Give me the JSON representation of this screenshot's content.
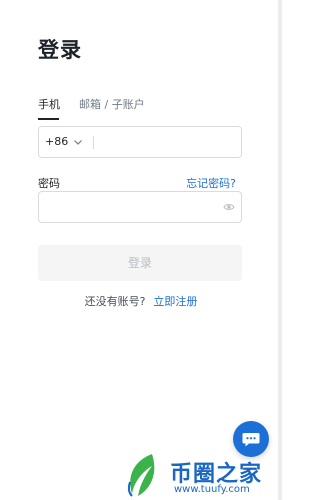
{
  "header": {
    "title": "登录"
  },
  "tabs": [
    {
      "label": "手机",
      "active": true
    },
    {
      "label": "邮箱 / 子账户",
      "active": false
    }
  ],
  "phone": {
    "country_code": "+86",
    "value": "",
    "chevron_icon": "chevron-down-icon"
  },
  "password": {
    "label": "密码",
    "forgot_label": "忘记密码?",
    "value": "",
    "toggle_icon": "eye-icon"
  },
  "login_button": {
    "label": "登录",
    "enabled": false
  },
  "signup": {
    "prompt": "还没有账号?",
    "link_label": "立即注册"
  },
  "chat": {
    "icon": "chat-bubble-icon"
  },
  "watermark": {
    "title": "币圈之家",
    "url": "www.tuufy.com"
  },
  "colors": {
    "accent": "#1c6fd6",
    "text_primary": "#1e2329",
    "text_secondary": "#707a8a",
    "button_disabled_bg": "#f5f5f5",
    "watermark_blue": "#1a66c2",
    "watermark_green": "#3cb34a"
  }
}
